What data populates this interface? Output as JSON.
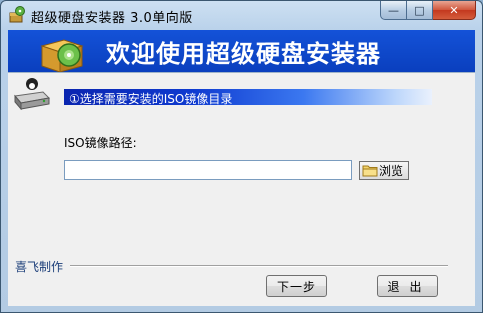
{
  "window": {
    "title": "超级硬盘安装器 3.0单向版",
    "controls": {
      "minimize": "—",
      "maximize": "□",
      "close": "✕"
    }
  },
  "banner": {
    "title": "欢迎使用超级硬盘安装器",
    "icon": "installer-box-icon"
  },
  "content": {
    "drive_icon": "hard-drive-icon",
    "step_text": "①选择需要安装的ISO镜像目录",
    "path_label": "ISO镜像路径:",
    "path_value": "",
    "browse_label": "浏览",
    "credit": "喜飞制作"
  },
  "buttons": {
    "next": "下一步",
    "exit": "退出"
  },
  "colors": {
    "banner": "#1452d8",
    "step_gradient_start": "#0a25b0",
    "close_button": "#c4381f"
  }
}
